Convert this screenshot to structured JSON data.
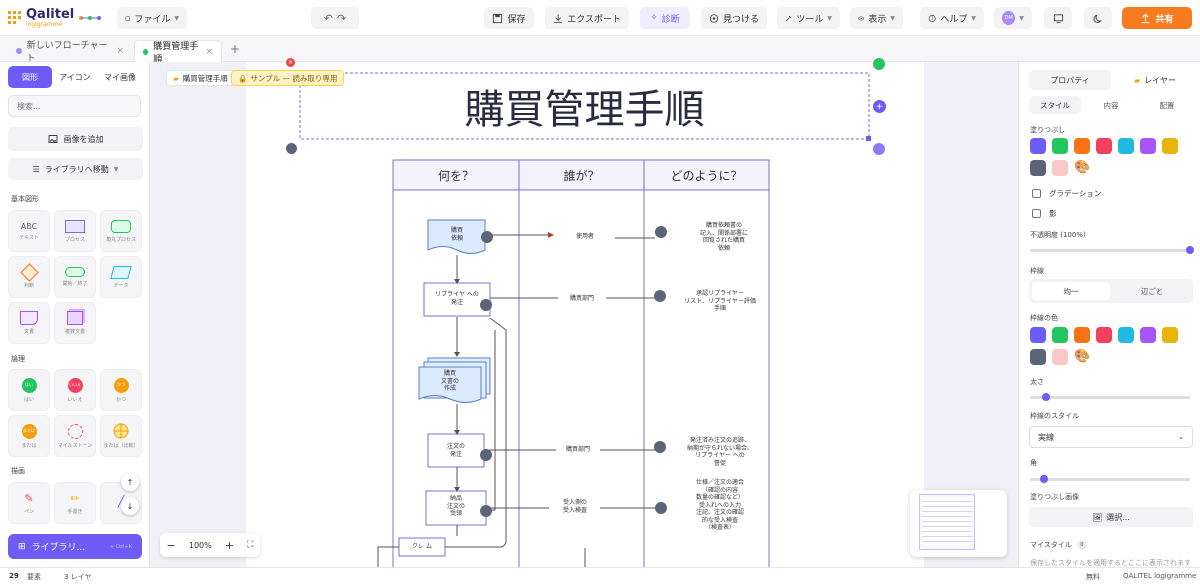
{
  "app": {
    "logo_text": "Qalitel",
    "logo_sub": "logigramme"
  },
  "topbar": {
    "file": "ファイル",
    "save": "保存",
    "export": "エクスポート",
    "diagnose": "診断",
    "find": "見つける",
    "tools": "ツール",
    "view": "表示",
    "help": "ヘルプ",
    "avatar": "DM",
    "share": "共有"
  },
  "tabs": [
    {
      "label": "新しいフローチャート",
      "close": "×"
    },
    {
      "label": "購買管理手順",
      "close": "×"
    }
  ],
  "tab_add": "+",
  "left": {
    "tabs": [
      "図形",
      "アイコン",
      "マイ画像"
    ],
    "search_placeholder": "検索...",
    "add_image": "画像を追加",
    "library_move": "ライブラリへ移動",
    "sections": {
      "basic": "基本図形",
      "logic": "論理",
      "draw": "描画"
    },
    "basic": [
      "テキスト",
      "プロセス",
      "角丸プロセス",
      "判断",
      "開始／終了",
      "データ",
      "文書",
      "複数文書"
    ],
    "basic_text": "ABC",
    "logic": [
      "はい",
      "いいえ",
      "かつ",
      "または",
      "マイルストーン",
      "または（比較）"
    ],
    "logic_marks": [
      "はい",
      "いいえ",
      "かつ",
      "または"
    ],
    "draw": [
      "ペン",
      "手書き",
      ""
    ],
    "library_btn": "ライブラリ...",
    "library_hint": "+ Ctrl+K"
  },
  "canvas": {
    "breadcrumb": "購買管理手順",
    "badge": "サンプル — 読み取り専用",
    "title": "購買管理手順",
    "lanes": [
      "何を？",
      "誰が？",
      "どのように？"
    ],
    "shapes": {
      "doc1": "購買\n依頼",
      "proc1": "リプライヤ への\n発注",
      "multidoc": "購買\n文書の\n作成",
      "proc2": "注文の\n発注",
      "proc3": "納品\n注文の\n受領",
      "claim": "クレ ム"
    },
    "who": [
      "使用者",
      "購買部門",
      "購買部門",
      "受入側の\n受入検査"
    ],
    "how": [
      "購買依頼書の\n記入、関係部署に\n回覧された購買\n依頼",
      "承認リプライヤー\nリスト、リプライヤー評価\n手順",
      "発注済み注文の追跡、\n納期が守られない場合、\nリプライヤー への\n督促",
      "仕様／注文の適合\n（確認の内容\n数量の確認など）\n受入れへの入力\n注記、注文の確認\n的な受入検査\n（検査表）"
    ],
    "zoom": "100%"
  },
  "right": {
    "tabs": [
      "プロパティ",
      "レイヤー"
    ],
    "subtabs": [
      "スタイル",
      "内容",
      "配置"
    ],
    "fill": "塗りつぶし",
    "gradient": "グラデーション",
    "shadow": "影",
    "opacity": "不透明度 (100%)",
    "stroke": "枠線",
    "stroke_modes": [
      "均一",
      "辺ごと"
    ],
    "stroke_color": "枠線の色",
    "thickness": "太さ",
    "stroke_style": "枠線のスタイル",
    "stroke_style_value": "実線",
    "corner": "角",
    "fill_image": "塗りつぶし画像",
    "select": "選択...",
    "my_styles": "マイスタイル",
    "my_styles_badge": "0",
    "cut_text": "保存したスタイルを適用するとここに表示されます"
  },
  "status": {
    "elements_count": "29",
    "elements": "要素",
    "layers": "3 レイヤ",
    "plan": "無料",
    "brand": "QALITEL logigramme"
  },
  "colors": {
    "accent": "#6d5cf5",
    "orange": "#f97b1f",
    "swatches": [
      "#6d5cf5",
      "#22c55e",
      "#f97316",
      "#f43f5e",
      "#22b8e6",
      "#a855f7",
      "#eab308",
      "#5b6478",
      "#f9c9c9"
    ],
    "lane_border": "#7b6fd6"
  },
  "help": "?"
}
